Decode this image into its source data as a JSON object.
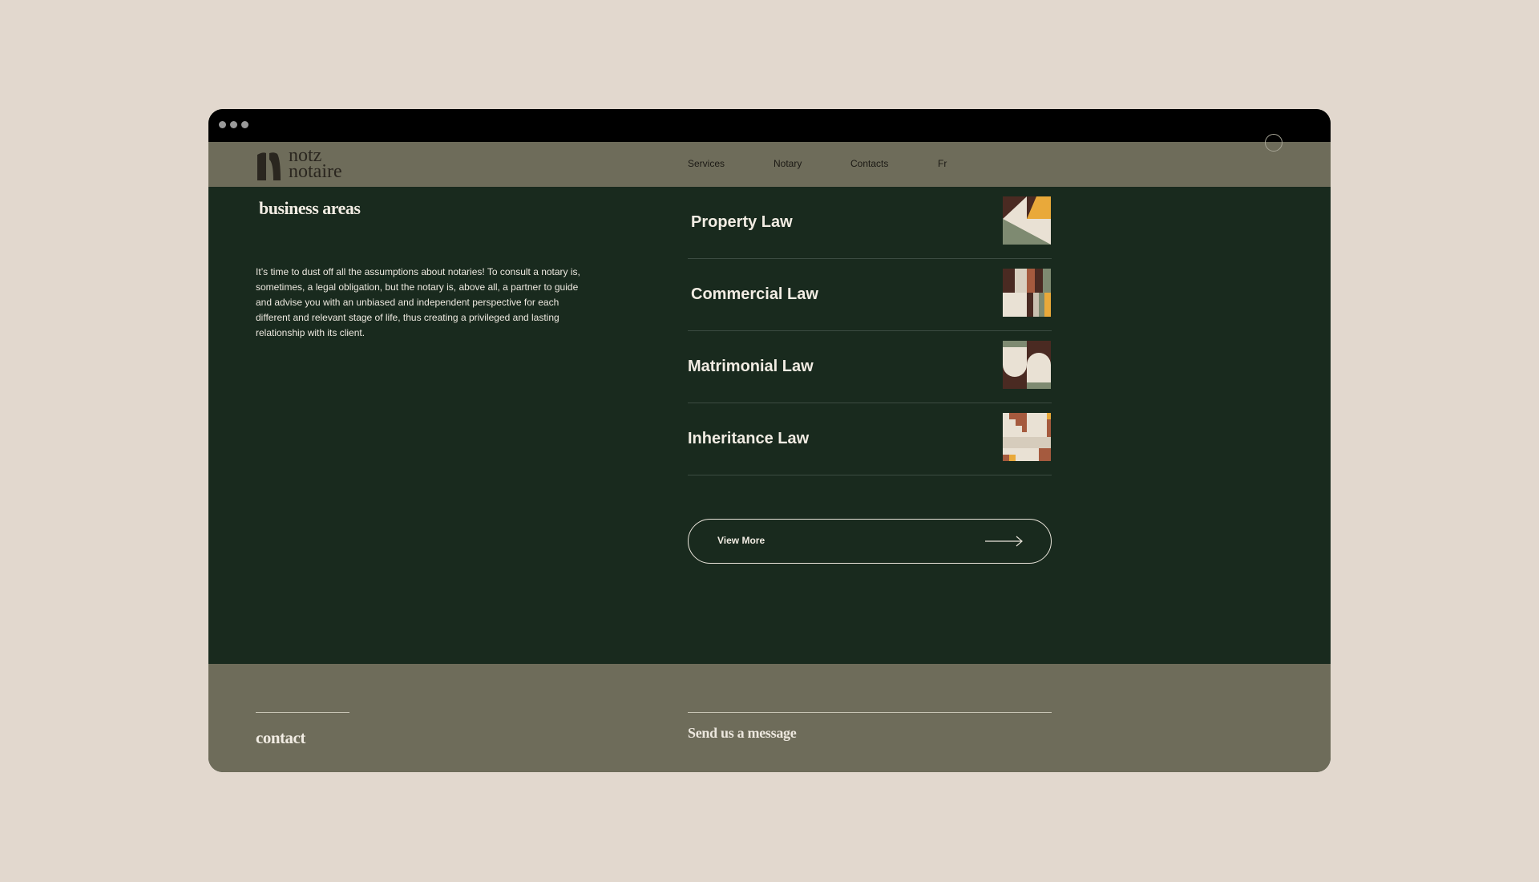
{
  "header": {
    "logo": {
      "line1": "notz",
      "line2": "notaire"
    },
    "nav": [
      {
        "label": "Services"
      },
      {
        "label": "Notary"
      },
      {
        "label": "Contacts"
      },
      {
        "label": "Fr"
      }
    ]
  },
  "business": {
    "title": "business areas",
    "intro": "It’s time to dust off all the assumptions about notaries! To consult a notary is, sometimes, a legal obligation, but the notary is, above all, a partner to guide and advise you with an unbiased and independent perspective for each different and relevant stage of life, thus creating a privileged and lasting relationship with its client.",
    "areas": [
      {
        "label": "Property Law",
        "icon": "property-law-pattern-icon"
      },
      {
        "label": "Commercial Law",
        "icon": "commercial-law-pattern-icon"
      },
      {
        "label": "Matrimonial Law",
        "icon": "matrimonial-law-pattern-icon"
      },
      {
        "label": "Inheritance Law",
        "icon": "inheritance-law-pattern-icon"
      }
    ],
    "view_more": "View More"
  },
  "footer": {
    "contact_title": "contact",
    "message_title": "Send us a message"
  },
  "colors": {
    "page_background": "#e2d8ce",
    "main_green": "#192a1e",
    "header_olive": "#6e6c5a",
    "accent_orange": "#e9a93a",
    "accent_brown": "#4a2a22",
    "accent_rust": "#a55a3e",
    "cream": "#e9e1d4"
  }
}
